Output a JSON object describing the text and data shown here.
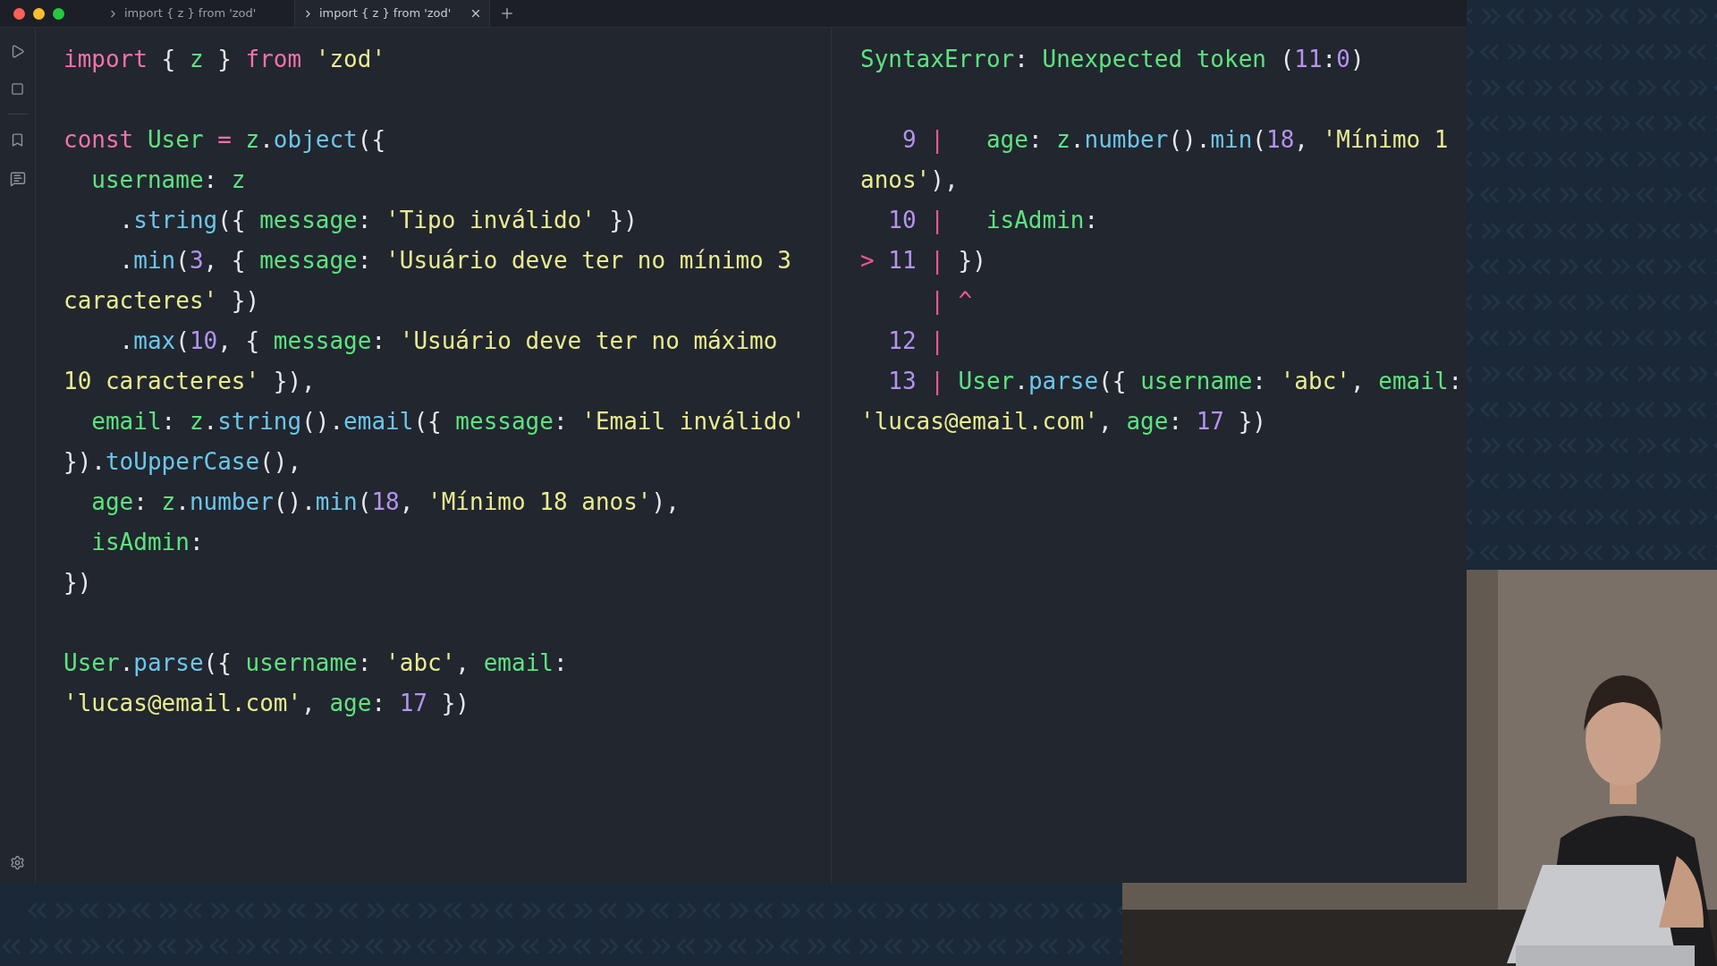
{
  "tabs": [
    {
      "label": "import { z } from 'zod'",
      "selected": false
    },
    {
      "label": "import { z } from 'zod'",
      "selected": true
    }
  ],
  "editor": {
    "lines": [
      {
        "kind": "code",
        "tokens": [
          {
            "kind": "kw",
            "text": "import"
          },
          {
            "kind": "p",
            "text": " { "
          },
          {
            "kind": "var",
            "text": "z"
          },
          {
            "kind": "p",
            "text": " } "
          },
          {
            "kind": "kw",
            "text": "from "
          },
          {
            "kind": "str",
            "text": "'zod'"
          }
        ]
      },
      {
        "kind": "blank"
      },
      {
        "kind": "code",
        "tokens": [
          {
            "kind": "kw",
            "text": "const "
          },
          {
            "kind": "var",
            "text": "User "
          },
          {
            "kind": "kw",
            "text": "= "
          },
          {
            "kind": "var",
            "text": "z"
          },
          {
            "kind": "p",
            "text": "."
          },
          {
            "kind": "fn",
            "text": "object"
          },
          {
            "kind": "p",
            "text": "({"
          }
        ]
      },
      {
        "kind": "code",
        "tokens": [
          {
            "kind": "var",
            "text": "  username"
          },
          {
            "kind": "p",
            "text": ": "
          },
          {
            "kind": "var",
            "text": "z"
          }
        ]
      },
      {
        "kind": "code",
        "tokens": [
          {
            "kind": "p",
            "text": "    ."
          },
          {
            "kind": "fn",
            "text": "string"
          },
          {
            "kind": "p",
            "text": "({ "
          },
          {
            "kind": "var",
            "text": "message"
          },
          {
            "kind": "p",
            "text": ": "
          },
          {
            "kind": "str",
            "text": "'Tipo inválido'"
          },
          {
            "kind": "p",
            "text": " })"
          }
        ]
      },
      {
        "kind": "code",
        "tokens": [
          {
            "kind": "p",
            "text": "    ."
          },
          {
            "kind": "fn",
            "text": "min"
          },
          {
            "kind": "p",
            "text": "("
          },
          {
            "kind": "num",
            "text": "3"
          },
          {
            "kind": "p",
            "text": ", { "
          },
          {
            "kind": "var",
            "text": "message"
          },
          {
            "kind": "p",
            "text": ": "
          },
          {
            "kind": "str",
            "text": "'Usuário deve ter no mínimo 3"
          }
        ]
      },
      {
        "kind": "code",
        "tokens": [
          {
            "kind": "str",
            "text": "caracteres'"
          },
          {
            "kind": "p",
            "text": " })"
          }
        ]
      },
      {
        "kind": "code",
        "tokens": [
          {
            "kind": "p",
            "text": "    ."
          },
          {
            "kind": "fn",
            "text": "max"
          },
          {
            "kind": "p",
            "text": "("
          },
          {
            "kind": "num",
            "text": "10"
          },
          {
            "kind": "p",
            "text": ", { "
          },
          {
            "kind": "var",
            "text": "message"
          },
          {
            "kind": "p",
            "text": ": "
          },
          {
            "kind": "str",
            "text": "'Usuário deve ter no máximo"
          }
        ]
      },
      {
        "kind": "code",
        "tokens": [
          {
            "kind": "str",
            "text": "10 caracteres'"
          },
          {
            "kind": "p",
            "text": " }),"
          }
        ]
      },
      {
        "kind": "code",
        "tokens": [
          {
            "kind": "var",
            "text": "  email"
          },
          {
            "kind": "p",
            "text": ": "
          },
          {
            "kind": "var",
            "text": "z"
          },
          {
            "kind": "p",
            "text": "."
          },
          {
            "kind": "fn",
            "text": "string"
          },
          {
            "kind": "p",
            "text": "()."
          },
          {
            "kind": "fn",
            "text": "email"
          },
          {
            "kind": "p",
            "text": "({ "
          },
          {
            "kind": "var",
            "text": "message"
          },
          {
            "kind": "p",
            "text": ": "
          },
          {
            "kind": "str",
            "text": "'Email inválido'"
          }
        ]
      },
      {
        "kind": "code",
        "tokens": [
          {
            "kind": "p",
            "text": "})."
          },
          {
            "kind": "fn",
            "text": "toUpperCase"
          },
          {
            "kind": "p",
            "text": "(),"
          }
        ]
      },
      {
        "kind": "code",
        "tokens": [
          {
            "kind": "var",
            "text": "  age"
          },
          {
            "kind": "p",
            "text": ": "
          },
          {
            "kind": "var",
            "text": "z"
          },
          {
            "kind": "p",
            "text": "."
          },
          {
            "kind": "fn",
            "text": "number"
          },
          {
            "kind": "p",
            "text": "()."
          },
          {
            "kind": "fn",
            "text": "min"
          },
          {
            "kind": "p",
            "text": "("
          },
          {
            "kind": "num",
            "text": "18"
          },
          {
            "kind": "p",
            "text": ", "
          },
          {
            "kind": "str",
            "text": "'Mínimo 18 anos'"
          },
          {
            "kind": "p",
            "text": "),"
          }
        ]
      },
      {
        "kind": "code",
        "tokens": [
          {
            "kind": "var",
            "text": "  isAdmin"
          },
          {
            "kind": "p",
            "text": ":"
          }
        ]
      },
      {
        "kind": "code",
        "tokens": [
          {
            "kind": "p",
            "text": "})"
          }
        ]
      },
      {
        "kind": "blank"
      },
      {
        "kind": "code",
        "tokens": [
          {
            "kind": "var",
            "text": "User"
          },
          {
            "kind": "p",
            "text": "."
          },
          {
            "kind": "fn",
            "text": "parse"
          },
          {
            "kind": "p",
            "text": "({ "
          },
          {
            "kind": "var",
            "text": "username"
          },
          {
            "kind": "p",
            "text": ": "
          },
          {
            "kind": "str",
            "text": "'abc'"
          },
          {
            "kind": "p",
            "text": ", "
          },
          {
            "kind": "var",
            "text": "email"
          },
          {
            "kind": "p",
            "text": ":"
          }
        ]
      },
      {
        "kind": "code",
        "tokens": [
          {
            "kind": "str",
            "text": "'lucas@email.com'"
          },
          {
            "kind": "p",
            "text": ", "
          },
          {
            "kind": "var",
            "text": "age"
          },
          {
            "kind": "p",
            "text": ": "
          },
          {
            "kind": "num",
            "text": "17"
          },
          {
            "kind": "p",
            "text": " })"
          }
        ]
      }
    ]
  },
  "output": {
    "lines": [
      {
        "kind": "code",
        "tokens": [
          {
            "kind": "var",
            "text": "SyntaxError"
          },
          {
            "kind": "p",
            "text": ": "
          },
          {
            "kind": "var",
            "text": "Unexpected token"
          },
          {
            "kind": "p",
            "text": " ("
          },
          {
            "kind": "num",
            "text": "11"
          },
          {
            "kind": "p",
            "text": ":"
          },
          {
            "kind": "num",
            "text": "0"
          },
          {
            "kind": "p",
            "text": ")"
          }
        ]
      },
      {
        "kind": "blank"
      },
      {
        "kind": "code",
        "tokens": [
          {
            "kind": "num",
            "text": "   9"
          },
          {
            "kind": "err",
            "text": " | "
          },
          {
            "kind": "var",
            "text": "  age"
          },
          {
            "kind": "p",
            "text": ": "
          },
          {
            "kind": "var",
            "text": "z"
          },
          {
            "kind": "p",
            "text": "."
          },
          {
            "kind": "fn",
            "text": "number"
          },
          {
            "kind": "p",
            "text": "()."
          },
          {
            "kind": "fn",
            "text": "min"
          },
          {
            "kind": "p",
            "text": "("
          },
          {
            "kind": "num",
            "text": "18"
          },
          {
            "kind": "p",
            "text": ", "
          },
          {
            "kind": "str",
            "text": "'Mínimo 1"
          }
        ]
      },
      {
        "kind": "code",
        "tokens": [
          {
            "kind": "str",
            "text": "anos'"
          },
          {
            "kind": "p",
            "text": "),"
          }
        ]
      },
      {
        "kind": "code",
        "tokens": [
          {
            "kind": "num",
            "text": "  10"
          },
          {
            "kind": "err",
            "text": " | "
          },
          {
            "kind": "var",
            "text": "  isAdmin"
          },
          {
            "kind": "p",
            "text": ":"
          }
        ]
      },
      {
        "kind": "code",
        "tokens": [
          {
            "kind": "err",
            "text": "> "
          },
          {
            "kind": "num",
            "text": "11"
          },
          {
            "kind": "err",
            "text": " | "
          },
          {
            "kind": "p",
            "text": "})"
          }
        ]
      },
      {
        "kind": "code",
        "tokens": [
          {
            "kind": "err",
            "text": "     | ^"
          }
        ]
      },
      {
        "kind": "code",
        "tokens": [
          {
            "kind": "num",
            "text": "  12"
          },
          {
            "kind": "err",
            "text": " |"
          }
        ]
      },
      {
        "kind": "code",
        "tokens": [
          {
            "kind": "num",
            "text": "  13"
          },
          {
            "kind": "err",
            "text": " | "
          },
          {
            "kind": "var",
            "text": "User"
          },
          {
            "kind": "p",
            "text": "."
          },
          {
            "kind": "fn",
            "text": "parse"
          },
          {
            "kind": "p",
            "text": "({ "
          },
          {
            "kind": "var",
            "text": "username"
          },
          {
            "kind": "p",
            "text": ": "
          },
          {
            "kind": "str",
            "text": "'abc'"
          },
          {
            "kind": "p",
            "text": ", "
          },
          {
            "kind": "var",
            "text": "email"
          },
          {
            "kind": "p",
            "text": ":"
          }
        ]
      },
      {
        "kind": "code",
        "tokens": [
          {
            "kind": "str",
            "text": "'lucas@email.com'"
          },
          {
            "kind": "p",
            "text": ", "
          },
          {
            "kind": "var",
            "text": "age"
          },
          {
            "kind": "p",
            "text": ": "
          },
          {
            "kind": "num",
            "text": "17"
          },
          {
            "kind": "p",
            "text": " })"
          }
        ]
      }
    ]
  }
}
